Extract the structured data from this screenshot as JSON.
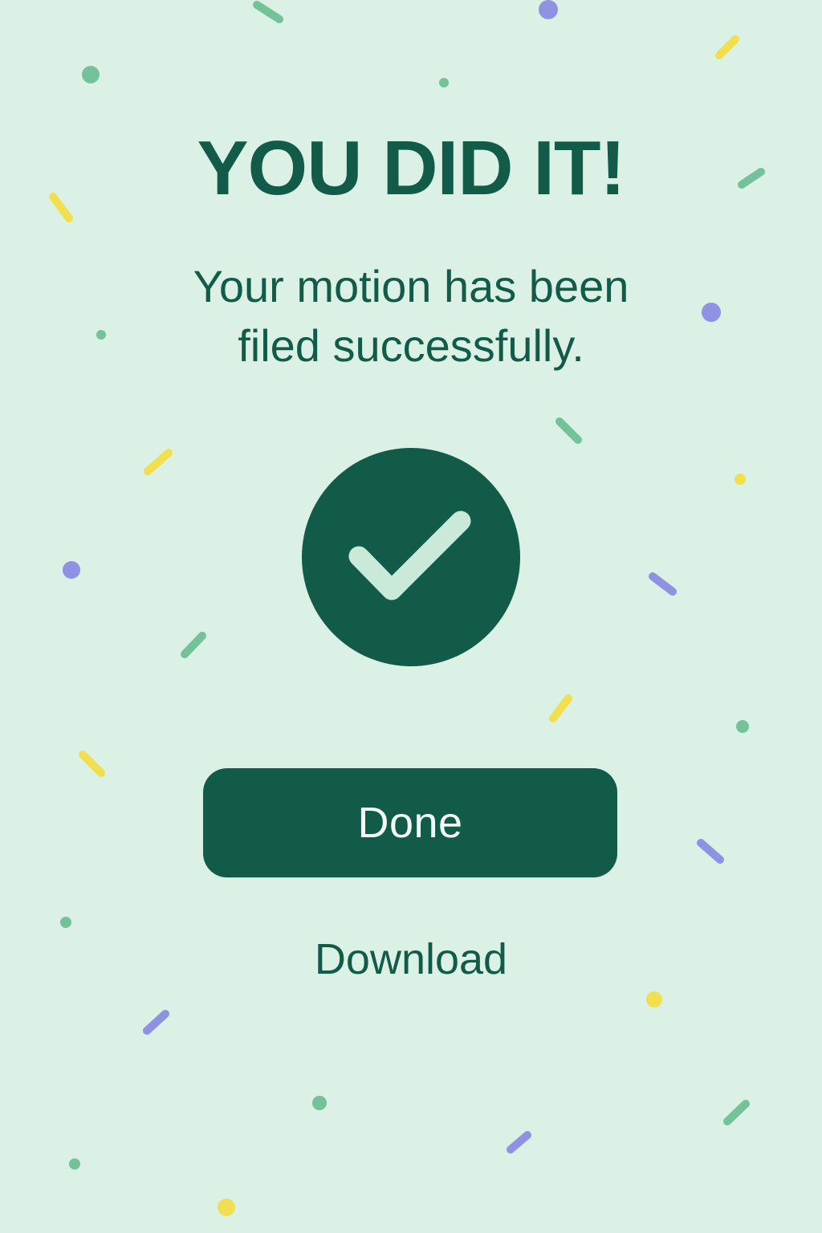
{
  "colors": {
    "background": "#dcf1e5",
    "primary": "#135b49",
    "primary_text": "#f3fbf6",
    "checkmark": "#c9ead8",
    "confetti_green": "#74c29a",
    "confetti_yellow": "#f2df4f",
    "confetti_purple": "#8f92e2"
  },
  "heading": {
    "title": "YOU DID IT!",
    "message": "Your motion has been filed successfully."
  },
  "status_icon": {
    "name": "checkmark-icon"
  },
  "actions": {
    "done_label": "Done",
    "download_label": "Download"
  },
  "decorations": {
    "icon": "confetti"
  }
}
